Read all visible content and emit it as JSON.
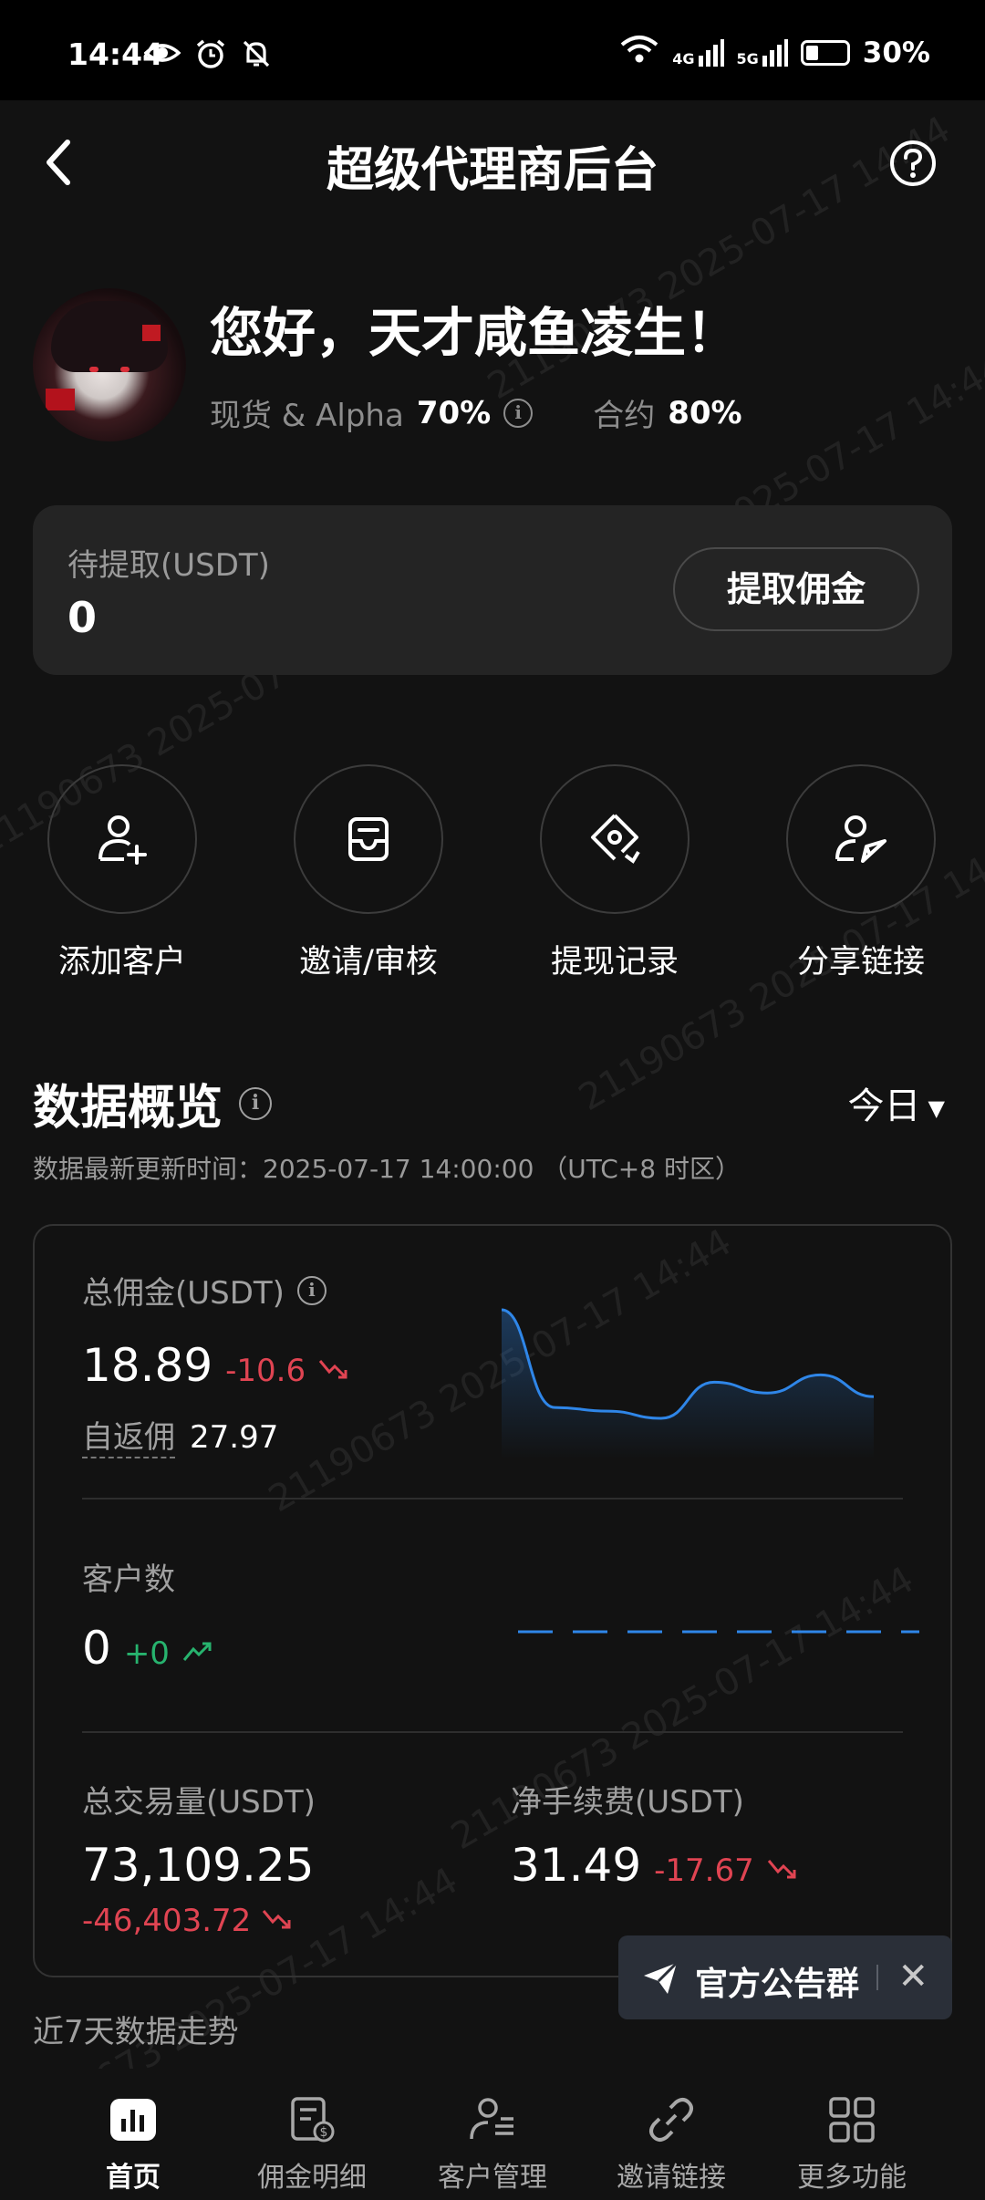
{
  "status_bar": {
    "time": "14:44",
    "network1": "4G",
    "network2": "5G",
    "battery": "30%",
    "battery_level": 0.3
  },
  "header": {
    "title": "超级代理商后台"
  },
  "profile": {
    "greeting": "您好，天才咸鱼凌生！",
    "spot_label": "现货 & Alpha",
    "spot_rate": "70%",
    "futures_label": "合约",
    "futures_rate": "80%"
  },
  "pending": {
    "label": "待提取(USDT)",
    "value": "0",
    "button": "提取佣金"
  },
  "actions": [
    {
      "label": "添加客户",
      "icon": "add-user-icon"
    },
    {
      "label": "邀请/审核",
      "icon": "inbox-icon"
    },
    {
      "label": "提现记录",
      "icon": "withdraw-record-icon"
    },
    {
      "label": "分享链接",
      "icon": "share-user-icon"
    }
  ],
  "overview": {
    "title": "数据概览",
    "period": "今日",
    "updated": "数据最新更新时间：2025-07-17 14:00:00 （UTC+8 时区）",
    "total_commission": {
      "label": "总佣金(USDT)",
      "value": "18.89",
      "change": "-10.6",
      "rebate_label": "自返佣",
      "rebate_value": "27.97"
    },
    "customers": {
      "label": "客户数",
      "value": "0",
      "change": "+0"
    },
    "volume": {
      "label": "总交易量(USDT)",
      "value": "73,109.25",
      "change": "-46,403.72"
    },
    "net_fee": {
      "label": "净手续费(USDT)",
      "value": "31.49",
      "change": "-17.67"
    },
    "trend_label": "近7天数据走势"
  },
  "sparkline_commission": [
    45,
    18,
    17,
    15,
    25,
    22,
    27,
    21
  ],
  "toast": {
    "label": "官方公告群"
  },
  "watermark": "21190673 2025-07-17 14:44",
  "tabs": [
    {
      "label": "首页",
      "icon": "home-chart-icon",
      "active": true
    },
    {
      "label": "佣金明细",
      "icon": "commission-detail-icon",
      "active": false
    },
    {
      "label": "客户管理",
      "icon": "customer-manage-icon",
      "active": false
    },
    {
      "label": "邀请链接",
      "icon": "link-icon",
      "active": false
    },
    {
      "label": "更多功能",
      "icon": "grid-icon",
      "active": false
    }
  ],
  "colors": {
    "negative": "#e04452",
    "positive": "#27b36e",
    "chart_line": "#2f86e8"
  }
}
